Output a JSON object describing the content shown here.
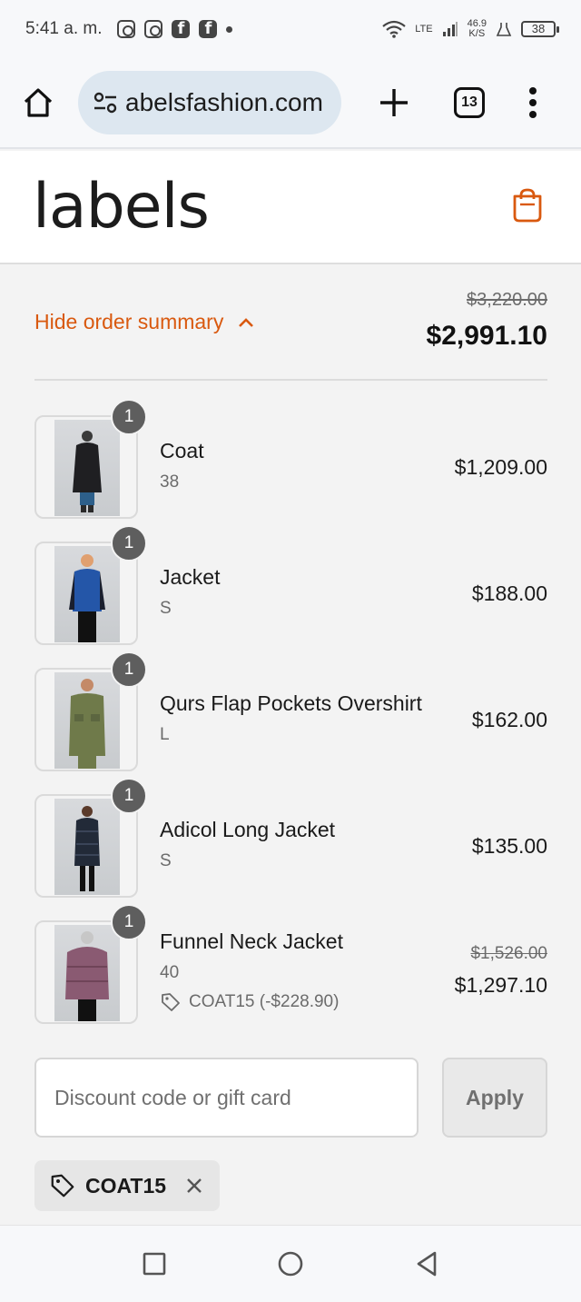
{
  "status_bar": {
    "time": "5:41 a. m.",
    "lte": "LTE",
    "speed_value": "46.9",
    "speed_unit": "K/S",
    "battery": "38"
  },
  "browser": {
    "url": "abelsfashion.com",
    "tab_count": "13"
  },
  "site": {
    "logo": "labels",
    "accent_color": "#d9590f"
  },
  "summary": {
    "toggle_label": "Hide order summary",
    "original_total": "$3,220.00",
    "total": "$2,991.10",
    "items": [
      {
        "title": "Coat",
        "variant": "38",
        "qty": "1",
        "price": "$1,209.00"
      },
      {
        "title": "Jacket",
        "variant": "S",
        "qty": "1",
        "price": "$188.00"
      },
      {
        "title": "Qurs Flap Pockets Overshirt",
        "variant": "L",
        "qty": "1",
        "price": "$162.00"
      },
      {
        "title": "Adicol Long Jacket",
        "variant": "S",
        "qty": "1",
        "price": "$135.00"
      },
      {
        "title": "Funnel Neck Jacket",
        "variant": "40",
        "qty": "1",
        "original_price": "$1,526.00",
        "price": "$1,297.10",
        "discount": "COAT15 (-$228.90)"
      }
    ]
  },
  "discount": {
    "placeholder": "Discount code or gift card",
    "apply_label": "Apply",
    "applied_code": "COAT15"
  }
}
